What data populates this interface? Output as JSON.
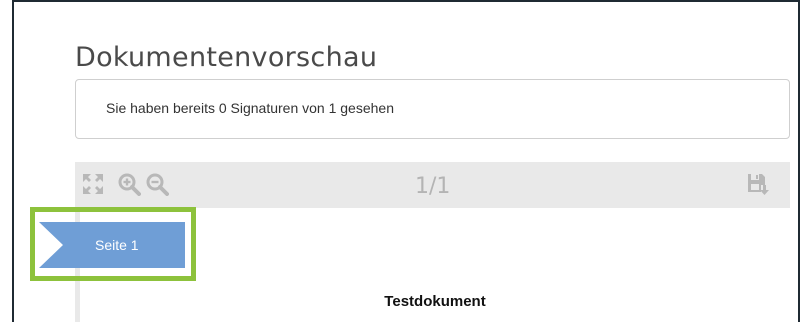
{
  "page": {
    "title": "Dokumentenvorschau"
  },
  "info": {
    "text": "Sie haben bereits 0 Signaturen von 1 gesehen"
  },
  "viewer": {
    "page_counter": "1/1",
    "toolbar": [
      {
        "icon": "fullscreen-icon"
      },
      {
        "icon": "zoom-in-icon"
      },
      {
        "icon": "zoom-out-icon"
      },
      {
        "icon": "save-download-icon"
      }
    ],
    "document_title": "Testdokument"
  },
  "page_marker": {
    "label": "Seite 1"
  },
  "colors": {
    "accent_green": "#8dc23c",
    "marker_blue": "#6f9ed6",
    "toolbar_bg": "#e9e9e9",
    "icon_gray": "#b8b8b8"
  }
}
